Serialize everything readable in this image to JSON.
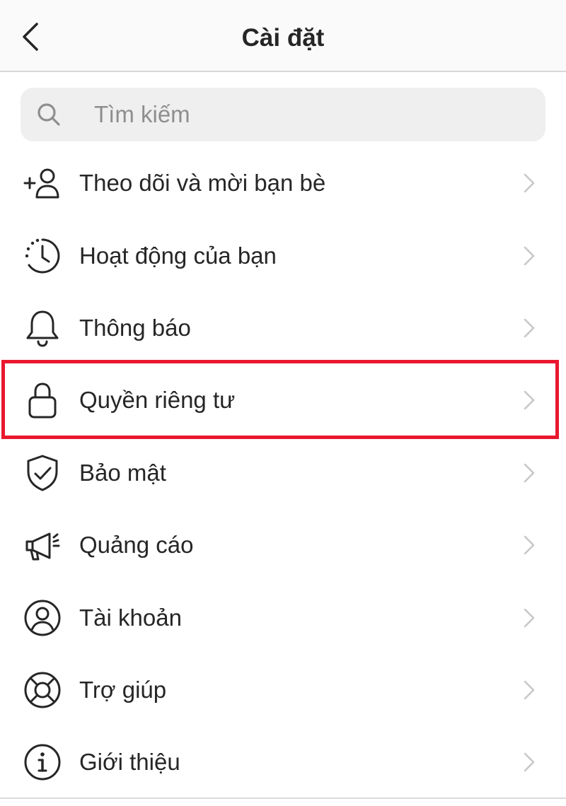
{
  "header": {
    "title": "Cài đặt",
    "back_icon": "chevron-left-icon"
  },
  "search": {
    "placeholder": "Tìm kiếm",
    "value": "",
    "icon": "search-icon"
  },
  "menu": {
    "items": [
      {
        "label": "Theo dõi và mời bạn bè",
        "icon": "add-person-icon"
      },
      {
        "label": "Hoạt động của bạn",
        "icon": "activity-clock-icon"
      },
      {
        "label": "Thông báo",
        "icon": "bell-icon"
      },
      {
        "label": "Quyền riêng tư",
        "icon": "lock-icon",
        "highlighted": true
      },
      {
        "label": "Bảo mật",
        "icon": "shield-check-icon"
      },
      {
        "label": "Quảng cáo",
        "icon": "megaphone-icon"
      },
      {
        "label": "Tài khoản",
        "icon": "account-circle-icon"
      },
      {
        "label": "Trợ giúp",
        "icon": "lifebuoy-icon"
      },
      {
        "label": "Giới thiệu",
        "icon": "info-icon"
      }
    ]
  },
  "colors": {
    "highlight_border": "#e8182e",
    "text": "#262626",
    "chevron": "#c7c7c7",
    "search_bg": "#efefef",
    "header_bg": "#fafafa"
  }
}
